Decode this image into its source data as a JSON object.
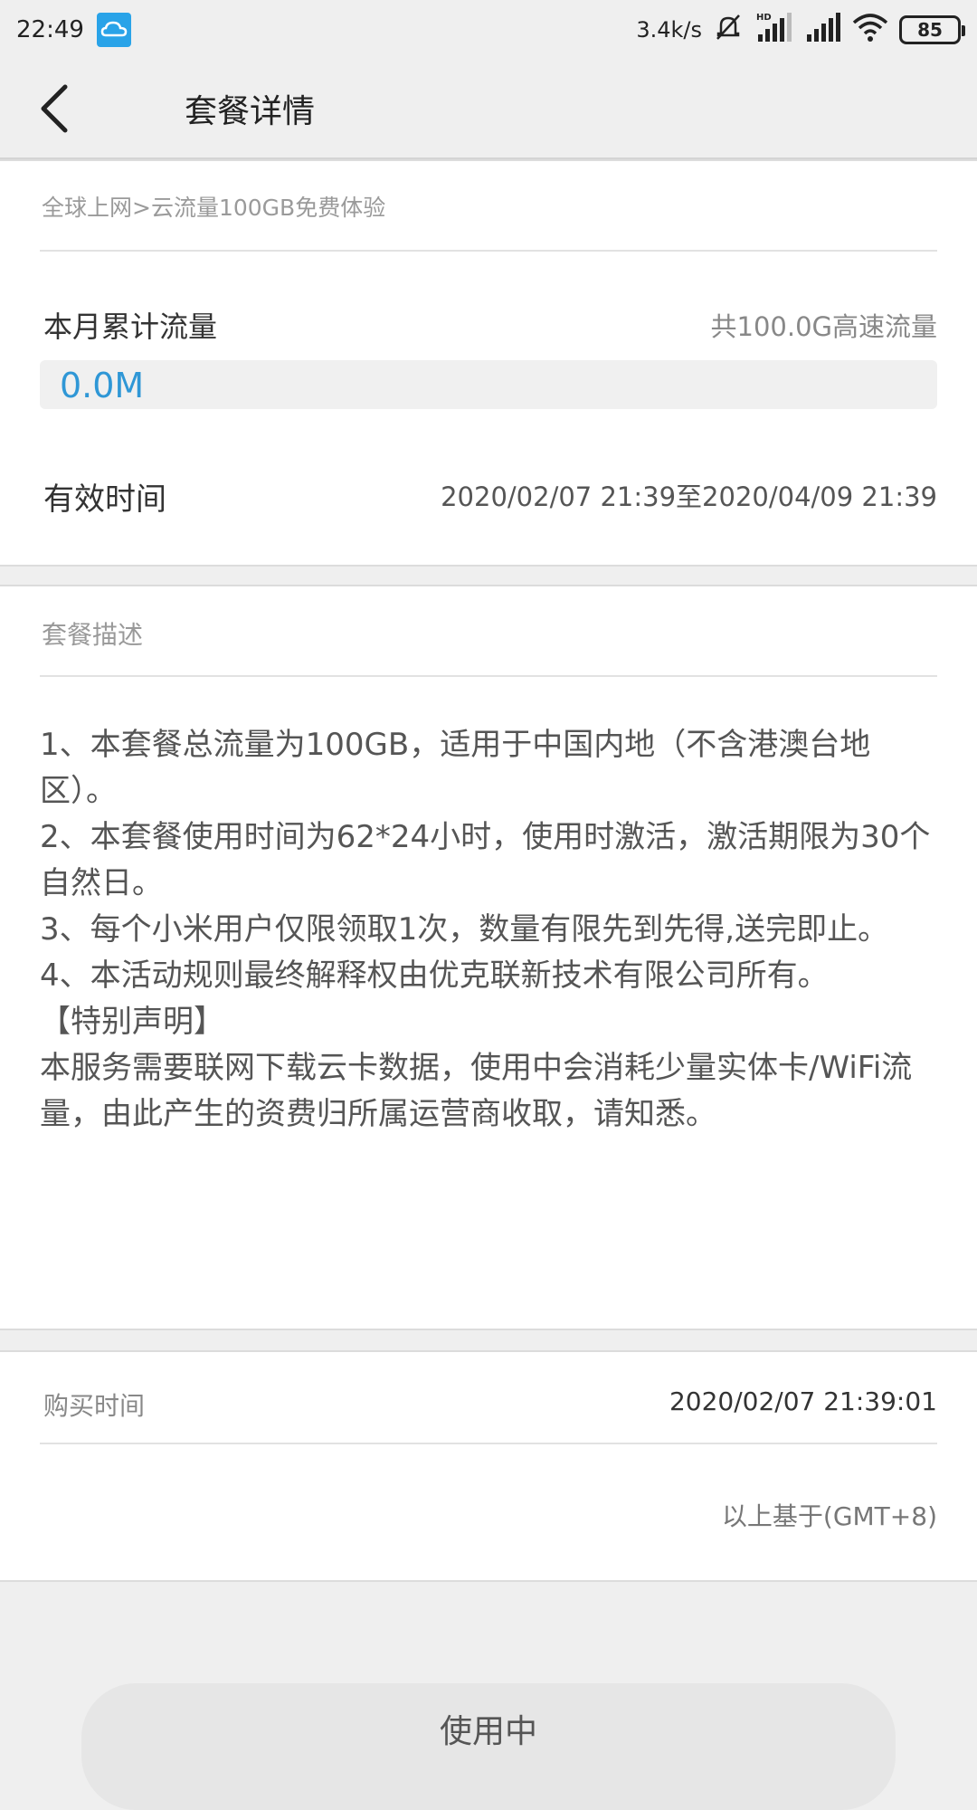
{
  "status_bar": {
    "time": "22:49",
    "net_speed": "3.4k/s",
    "battery": "85",
    "icons": [
      "cloud-icon",
      "mute-icon",
      "hd-signal-icon",
      "signal-icon",
      "wifi-icon",
      "battery-icon"
    ]
  },
  "header": {
    "title": "套餐详情",
    "back_icon": "chevron-left-icon"
  },
  "package": {
    "breadcrumb": "全球上网>云流量100GB免费体验",
    "monthly_label": "本月累计流量",
    "total_label": "共100.0G高速流量",
    "used_value": "0.0M",
    "used_fraction": 0.0,
    "valid_label": "有效时间",
    "valid_value": "2020/02/07 21:39至2020/04/09 21:39"
  },
  "description": {
    "title": "套餐描述",
    "lines": [
      "1、本套餐总流量为100GB，适用于中国内地（不含港澳台地区）。",
      "2、本套餐使用时间为62*24小时，使用时激活，激活期限为30个自然日。",
      "3、每个小米用户仅限领取1次，数量有限先到先得,送完即止。",
      "4、本活动规则最终解释权由优克联新技术有限公司所有。",
      "【特别声明】",
      "本服务需要联网下载云卡数据，使用中会消耗少量实体卡/WiFi流量，由此产生的资费归所属运营商收取，请知悉。"
    ]
  },
  "purchase": {
    "label": "购买时间",
    "value": "2020/02/07 21:39:01",
    "timezone_note": "以上基于(GMT+8)"
  },
  "footer": {
    "button_label": "使用中"
  },
  "colors": {
    "accent": "#2f97d6",
    "background": "#efefef",
    "card": "#ffffff"
  }
}
